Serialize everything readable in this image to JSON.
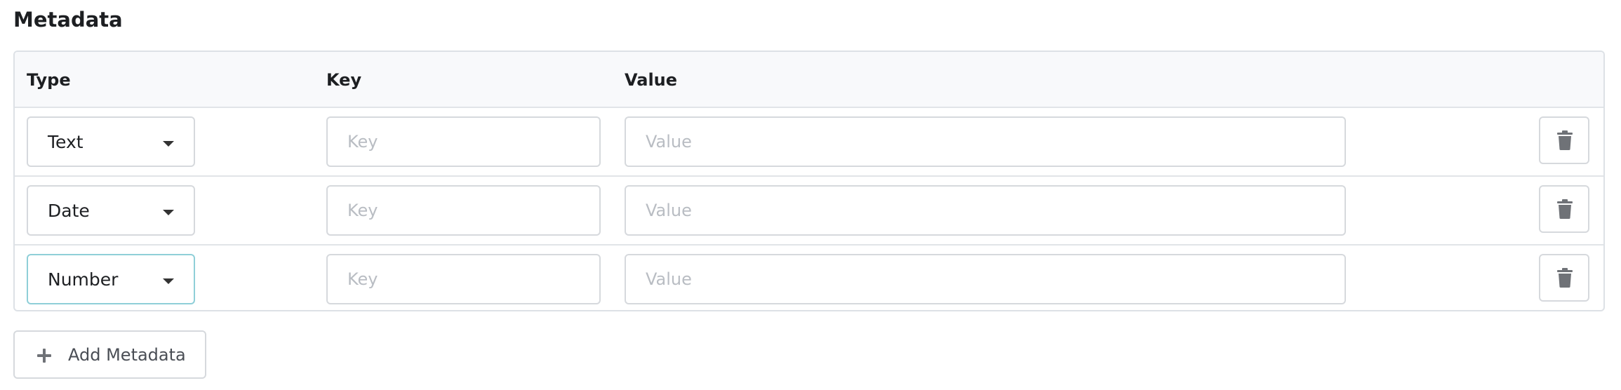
{
  "section": {
    "title": "Metadata"
  },
  "table": {
    "headers": {
      "type": "Type",
      "key": "Key",
      "value": "Value"
    },
    "rows": [
      {
        "type": "Text",
        "key": "",
        "value": "",
        "key_placeholder": "Key",
        "value_placeholder": "Value",
        "focused": false
      },
      {
        "type": "Date",
        "key": "",
        "value": "",
        "key_placeholder": "Key",
        "value_placeholder": "Value",
        "focused": false
      },
      {
        "type": "Number",
        "key": "",
        "value": "",
        "key_placeholder": "Key",
        "value_placeholder": "Value",
        "focused": true
      }
    ]
  },
  "actions": {
    "add_label": "Add Metadata"
  },
  "icons": {
    "delete": "trash-icon",
    "dropdown": "caret-down-icon",
    "add": "plus-icon"
  },
  "colors": {
    "focus_border": "#8fcfd8",
    "icon_gray": "#6f7277"
  }
}
